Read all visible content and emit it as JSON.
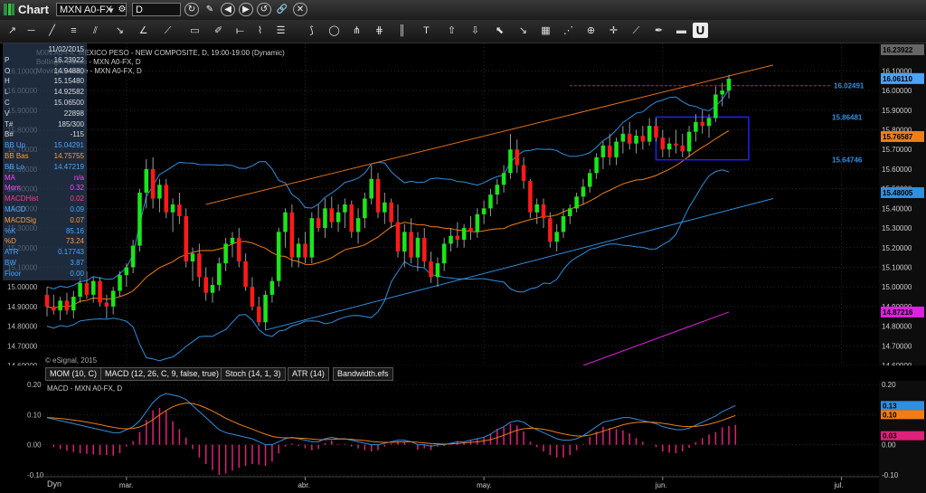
{
  "window": {
    "title": "Chart",
    "symbol": "MXN A0-FX",
    "interval": "D"
  },
  "icons": {
    "toolbar_top": [
      "refresh-icon",
      "pencil-icon",
      "back-icon",
      "forward-icon",
      "refresh-cycle-icon",
      "link-icon",
      "close-icon"
    ],
    "toolbar_tools": [
      "cursor-icon",
      "zoom-icon",
      "crosshair-icon"
    ]
  },
  "legend": {
    "line1": "MXN A0-FX, MEXICO PESO - NEW COMPOSITE, D, 19:00-19:00 (Dynamic)",
    "line2": "Bollinger Bands - MXN A0-FX, D",
    "line3": "Moving Average - MXN A0-FX, D",
    "watermark": "© eSignal, 2015"
  },
  "data_window": [
    {
      "k": "",
      "v": "11/02/2015",
      "color": "#ddd"
    },
    {
      "k": "P",
      "v": "16.23922",
      "color": "#ddd"
    },
    {
      "k": "O",
      "v": "14.94880",
      "color": "#ddd"
    },
    {
      "k": "H",
      "v": "15.15480",
      "color": "#ddd"
    },
    {
      "k": "L",
      "v": "14.92582",
      "color": "#ddd"
    },
    {
      "k": "C",
      "v": "15.06500",
      "color": "#ddd"
    },
    {
      "k": "V",
      "v": "22898",
      "color": "#ddd"
    },
    {
      "k": "T#",
      "v": "185/300",
      "color": "#ddd"
    },
    {
      "k": "B#",
      "v": "-115",
      "color": "#ddd"
    },
    {
      "k": "BB Up",
      "v": "15.04291",
      "color": "#4aa3ff"
    },
    {
      "k": "BB Bas",
      "v": "14.75755",
      "color": "#ff9a3c"
    },
    {
      "k": "BB Lo",
      "v": "14.47219",
      "color": "#4aa3ff"
    },
    {
      "k": "MA",
      "v": "n/a",
      "color": "#ff40ff"
    },
    {
      "k": "Mom",
      "v": "0.32",
      "color": "#ff40ff"
    },
    {
      "k": "MACDHist",
      "v": "0.02",
      "color": "#ff3a8a"
    },
    {
      "k": "MACD",
      "v": "0.09",
      "color": "#4aa3ff"
    },
    {
      "k": "MACDSig",
      "v": "0.07",
      "color": "#ff9a3c"
    },
    {
      "k": "%K",
      "v": "85.16",
      "color": "#4aa3ff"
    },
    {
      "k": "%D",
      "v": "73.24",
      "color": "#ff9a3c"
    },
    {
      "k": "ATR",
      "v": "0.17743",
      "color": "#4aa3ff"
    },
    {
      "k": "BW",
      "v": "3.87",
      "color": "#4aa3ff"
    },
    {
      "k": "Floor",
      "v": "0.00",
      "color": "#4aa3ff"
    }
  ],
  "indicator_tabs": [
    "MOM (10, C)",
    "MACD (12, 26, C, 9, false, true)",
    "Stoch (14, 1, 3)",
    "ATR (14)",
    "Bandwidth.efs"
  ],
  "macd_legend": "MACD - MXN A0-FX, D",
  "colors": {
    "up": "#19e619",
    "down": "#ff1a1a",
    "bb": "#2f8fe0",
    "ma": "#f07d16",
    "upper_trend": "#e0701a",
    "lower_trend": "#2f8fe0",
    "magenta_line": "#e020e0",
    "resistance": "#e02020",
    "box": "#2020ff",
    "macd": "#2f8fe0",
    "signal": "#f07d16",
    "hist": "#e0207a",
    "grid": "#2a2a2a"
  },
  "chart_data": [
    {
      "type": "candlestick",
      "title": "MXN A0-FX, MEXICO PESO - NEW COMPOSITE, D",
      "x_labels": [
        "mar.",
        "abr.",
        "may.",
        "jun.",
        "jul."
      ],
      "x_label_index": [
        12,
        39,
        66,
        93,
        120
      ],
      "ylim": [
        14.6,
        16.24
      ],
      "y_ticks": [
        "16.10000",
        "16.00000",
        "15.90000",
        "15.80000",
        "15.70000",
        "15.60000",
        "15.50000",
        "15.40000",
        "15.30000",
        "15.20000",
        "15.10000",
        "15.00000",
        "14.90000",
        "14.80000",
        "14.70000",
        "14.60000"
      ],
      "y_tick_values": [
        16.1,
        16.0,
        15.9,
        15.8,
        15.7,
        15.6,
        15.5,
        15.4,
        15.3,
        15.2,
        15.1,
        15.0,
        14.9,
        14.8,
        14.7,
        14.6
      ],
      "price_labels": [
        {
          "text": "16.23922",
          "value": 16.23922,
          "bg": "#666666"
        },
        {
          "text": "16.06110",
          "value": 16.0611,
          "bg": "#4aa3ff"
        },
        {
          "text": "15.76587",
          "value": 15.76587,
          "bg": "#f07d16"
        },
        {
          "text": "15.48005",
          "value": 15.48005,
          "bg": "#2f8fe0"
        },
        {
          "text": "14.87216",
          "value": 14.87216,
          "bg": "#e020e0"
        }
      ],
      "annotations": [
        {
          "text": "16.02491",
          "index": 116,
          "value": 16.02491,
          "color": "#2f8fe0"
        },
        {
          "text": "15.86481",
          "index": 106,
          "value": 15.86481,
          "color": "#2f8fe0"
        },
        {
          "text": "15.64746",
          "index": 108,
          "value": 15.64746,
          "color": "#2f8fe0"
        }
      ],
      "candles": [
        [
          14.96,
          15.0,
          14.85,
          14.9
        ],
        [
          14.9,
          14.96,
          14.86,
          14.88
        ],
        [
          14.88,
          14.95,
          14.83,
          14.93
        ],
        [
          14.93,
          14.97,
          14.86,
          14.88
        ],
        [
          14.88,
          14.98,
          14.84,
          14.95
        ],
        [
          14.95,
          15.05,
          14.92,
          15.02
        ],
        [
          15.02,
          15.08,
          14.94,
          14.96
        ],
        [
          14.96,
          15.05,
          14.92,
          15.03
        ],
        [
          15.03,
          15.05,
          14.9,
          14.92
        ],
        [
          14.92,
          14.96,
          14.84,
          14.9
        ],
        [
          14.9,
          15.0,
          14.86,
          14.98
        ],
        [
          14.98,
          15.08,
          14.95,
          15.06
        ],
        [
          15.06,
          15.12,
          15.0,
          15.1
        ],
        [
          15.1,
          15.24,
          15.07,
          15.21
        ],
        [
          15.21,
          15.5,
          15.18,
          15.48
        ],
        [
          15.48,
          15.65,
          15.4,
          15.6
        ],
        [
          15.6,
          15.66,
          15.4,
          15.45
        ],
        [
          15.45,
          15.55,
          15.38,
          15.52
        ],
        [
          15.52,
          15.55,
          15.35,
          15.38
        ],
        [
          15.38,
          15.45,
          15.28,
          15.42
        ],
        [
          15.42,
          15.48,
          15.32,
          15.36
        ],
        [
          15.36,
          15.4,
          15.1,
          15.13
        ],
        [
          15.13,
          15.2,
          15.03,
          15.17
        ],
        [
          15.17,
          15.22,
          15.0,
          15.05
        ],
        [
          15.05,
          15.1,
          14.93,
          14.97
        ],
        [
          14.97,
          15.05,
          14.92,
          15.01
        ],
        [
          15.01,
          15.15,
          14.98,
          15.12
        ],
        [
          15.12,
          15.25,
          15.08,
          15.22
        ],
        [
          15.22,
          15.28,
          15.15,
          15.25
        ],
        [
          15.25,
          15.3,
          15.1,
          15.13
        ],
        [
          15.13,
          15.17,
          14.98,
          15.0
        ],
        [
          15.0,
          15.05,
          14.88,
          14.9
        ],
        [
          14.9,
          14.95,
          14.8,
          14.82
        ],
        [
          14.82,
          14.98,
          14.78,
          14.96
        ],
        [
          14.96,
          15.05,
          14.92,
          15.03
        ],
        [
          15.03,
          15.3,
          15.0,
          15.28
        ],
        [
          15.28,
          15.4,
          15.2,
          15.38
        ],
        [
          15.38,
          15.42,
          15.1,
          15.15
        ],
        [
          15.15,
          15.25,
          15.1,
          15.22
        ],
        [
          15.22,
          15.28,
          15.12,
          15.15
        ],
        [
          15.15,
          15.38,
          15.12,
          15.35
        ],
        [
          15.35,
          15.42,
          15.28,
          15.3
        ],
        [
          15.3,
          15.45,
          15.25,
          15.4
        ],
        [
          15.4,
          15.46,
          15.3,
          15.33
        ],
        [
          15.33,
          15.42,
          15.28,
          15.38
        ],
        [
          15.38,
          15.45,
          15.3,
          15.42
        ],
        [
          15.42,
          15.44,
          15.25,
          15.28
        ],
        [
          15.28,
          15.4,
          15.22,
          15.35
        ],
        [
          15.35,
          15.48,
          15.3,
          15.45
        ],
        [
          15.45,
          15.62,
          15.42,
          15.55
        ],
        [
          15.55,
          15.58,
          15.35,
          15.38
        ],
        [
          15.38,
          15.48,
          15.32,
          15.43
        ],
        [
          15.43,
          15.45,
          15.3,
          15.33
        ],
        [
          15.33,
          15.42,
          15.15,
          15.18
        ],
        [
          15.18,
          15.32,
          15.1,
          15.28
        ],
        [
          15.28,
          15.35,
          15.12,
          15.15
        ],
        [
          15.15,
          15.28,
          15.08,
          15.25
        ],
        [
          15.25,
          15.3,
          15.1,
          15.13
        ],
        [
          15.13,
          15.18,
          15.02,
          15.05
        ],
        [
          15.05,
          15.15,
          15.0,
          15.12
        ],
        [
          15.12,
          15.25,
          15.08,
          15.22
        ],
        [
          15.22,
          15.3,
          15.18,
          15.26
        ],
        [
          15.26,
          15.33,
          15.2,
          15.24
        ],
        [
          15.24,
          15.32,
          15.2,
          15.3
        ],
        [
          15.3,
          15.36,
          15.24,
          15.28
        ],
        [
          15.28,
          15.4,
          15.25,
          15.37
        ],
        [
          15.37,
          15.44,
          15.32,
          15.4
        ],
        [
          15.4,
          15.5,
          15.36,
          15.47
        ],
        [
          15.47,
          15.55,
          15.42,
          15.52
        ],
        [
          15.52,
          15.62,
          15.48,
          15.58
        ],
        [
          15.58,
          15.78,
          15.55,
          15.7
        ],
        [
          15.7,
          15.75,
          15.58,
          15.62
        ],
        [
          15.62,
          15.66,
          15.5,
          15.54
        ],
        [
          15.54,
          15.55,
          15.35,
          15.38
        ],
        [
          15.38,
          15.45,
          15.32,
          15.42
        ],
        [
          15.42,
          15.45,
          15.3,
          15.35
        ],
        [
          15.35,
          15.38,
          15.2,
          15.23
        ],
        [
          15.23,
          15.32,
          15.18,
          15.28
        ],
        [
          15.28,
          15.4,
          15.25,
          15.36
        ],
        [
          15.36,
          15.42,
          15.32,
          15.4
        ],
        [
          15.4,
          15.48,
          15.38,
          15.46
        ],
        [
          15.46,
          15.55,
          15.42,
          15.51
        ],
        [
          15.51,
          15.6,
          15.48,
          15.58
        ],
        [
          15.58,
          15.68,
          15.55,
          15.66
        ],
        [
          15.66,
          15.74,
          15.6,
          15.72
        ],
        [
          15.72,
          15.78,
          15.62,
          15.66
        ],
        [
          15.66,
          15.76,
          15.62,
          15.74
        ],
        [
          15.74,
          15.82,
          15.68,
          15.78
        ],
        [
          15.78,
          15.84,
          15.7,
          15.73
        ],
        [
          15.73,
          15.8,
          15.68,
          15.77
        ],
        [
          15.77,
          15.82,
          15.7,
          15.74
        ],
        [
          15.74,
          15.86,
          15.72,
          15.82
        ],
        [
          15.82,
          15.86,
          15.74,
          15.76
        ],
        [
          15.76,
          15.8,
          15.66,
          15.7
        ],
        [
          15.7,
          15.76,
          15.66,
          15.73
        ],
        [
          15.73,
          15.8,
          15.68,
          15.72
        ],
        [
          15.72,
          15.78,
          15.66,
          15.69
        ],
        [
          15.69,
          15.82,
          15.66,
          15.79
        ],
        [
          15.79,
          15.88,
          15.74,
          15.84
        ],
        [
          15.84,
          15.9,
          15.78,
          15.82
        ],
        [
          15.82,
          15.88,
          15.76,
          15.86
        ],
        [
          15.86,
          16.02,
          15.84,
          15.98
        ],
        [
          15.98,
          16.04,
          15.92,
          16.0
        ],
        [
          16.0,
          16.08,
          15.96,
          16.06
        ]
      ]
    },
    {
      "type": "line",
      "title": "MACD - MXN A0-FX, D",
      "ylim": [
        -0.1,
        0.2
      ],
      "y_ticks": [
        "0.20",
        "0.10",
        "0.00",
        "-0.10"
      ],
      "y_tick_values": [
        0.2,
        0.1,
        0.0,
        -0.1
      ],
      "price_labels": [
        {
          "text": "0.13",
          "value": 0.13,
          "bg": "#2f8fe0"
        },
        {
          "text": "0.10",
          "value": 0.1,
          "bg": "#f07d16"
        },
        {
          "text": "0.03",
          "value": 0.03,
          "bg": "#e0207a"
        }
      ],
      "series": [
        {
          "name": "MACD",
          "values": [
            0.09,
            0.085,
            0.08,
            0.075,
            0.07,
            0.065,
            0.06,
            0.055,
            0.05,
            0.045,
            0.04,
            0.04,
            0.05,
            0.06,
            0.08,
            0.11,
            0.14,
            0.16,
            0.17,
            0.165,
            0.16,
            0.15,
            0.13,
            0.11,
            0.09,
            0.07,
            0.05,
            0.04,
            0.035,
            0.03,
            0.025,
            0.02,
            0.01,
            0.0,
            0.0,
            0.01,
            0.02,
            0.025,
            0.02,
            0.015,
            0.01,
            0.01,
            0.02,
            0.025,
            0.02,
            0.02,
            0.015,
            0.01,
            0.005,
            0.0,
            0.0,
            0.005,
            0.01,
            0.015,
            0.015,
            0.01,
            0.0,
            0.0,
            -0.005,
            0.0,
            0.0,
            0.005,
            0.01,
            0.01,
            0.015,
            0.02,
            0.025,
            0.035,
            0.05,
            0.06,
            0.075,
            0.08,
            0.075,
            0.06,
            0.05,
            0.04,
            0.03,
            0.02,
            0.015,
            0.015,
            0.02,
            0.03,
            0.045,
            0.06,
            0.075,
            0.08,
            0.085,
            0.09,
            0.09,
            0.085,
            0.08,
            0.075,
            0.07,
            0.06,
            0.055,
            0.05,
            0.05,
            0.055,
            0.065,
            0.075,
            0.085,
            0.095,
            0.11,
            0.12,
            0.13
          ]
        },
        {
          "name": "Signal",
          "values": [
            0.09,
            0.089,
            0.087,
            0.085,
            0.082,
            0.079,
            0.075,
            0.071,
            0.067,
            0.062,
            0.058,
            0.054,
            0.053,
            0.054,
            0.059,
            0.069,
            0.083,
            0.099,
            0.114,
            0.126,
            0.134,
            0.138,
            0.137,
            0.131,
            0.122,
            0.112,
            0.1,
            0.088,
            0.078,
            0.068,
            0.06,
            0.052,
            0.043,
            0.035,
            0.028,
            0.024,
            0.023,
            0.023,
            0.022,
            0.021,
            0.019,
            0.017,
            0.017,
            0.018,
            0.019,
            0.019,
            0.018,
            0.016,
            0.014,
            0.011,
            0.009,
            0.008,
            0.008,
            0.009,
            0.01,
            0.01,
            0.008,
            0.006,
            0.004,
            0.003,
            0.002,
            0.003,
            0.004,
            0.006,
            0.008,
            0.01,
            0.013,
            0.017,
            0.024,
            0.031,
            0.04,
            0.048,
            0.053,
            0.055,
            0.054,
            0.051,
            0.047,
            0.041,
            0.036,
            0.032,
            0.029,
            0.029,
            0.032,
            0.038,
            0.045,
            0.052,
            0.059,
            0.066,
            0.071,
            0.074,
            0.075,
            0.075,
            0.074,
            0.071,
            0.068,
            0.064,
            0.061,
            0.06,
            0.061,
            0.064,
            0.068,
            0.074,
            0.081,
            0.089,
            0.097
          ]
        }
      ]
    }
  ]
}
